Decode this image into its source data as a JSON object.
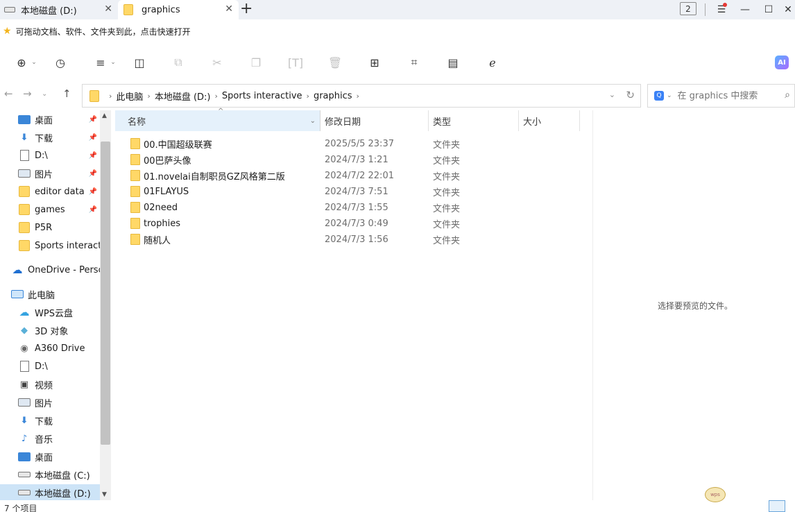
{
  "tabs": [
    {
      "label": "本地磁盘 (D:)",
      "icon": "drive-icon"
    },
    {
      "label": "graphics",
      "icon": "folder-icon"
    }
  ],
  "window": {
    "badge_count": "2"
  },
  "quickbar": {
    "text": "可拖动文档、软件、文件夹到此，点击快速打开"
  },
  "ai_label": "AI",
  "breadcrumb": [
    "此电脑",
    "本地磁盘 (D:)",
    "Sports interactive",
    "graphics"
  ],
  "search": {
    "placeholder": "在 graphics 中搜索"
  },
  "nav": {
    "quick_access": [
      {
        "label": "桌面",
        "icon": "desktop-icon",
        "pinned": true
      },
      {
        "label": "下载",
        "icon": "download-icon",
        "pinned": true
      },
      {
        "label": "D:\\",
        "icon": "document-icon",
        "pinned": true
      },
      {
        "label": "图片",
        "icon": "pictures-icon",
        "pinned": true
      },
      {
        "label": "editor data",
        "icon": "folder-icon",
        "pinned": true
      },
      {
        "label": "games",
        "icon": "folder-icon",
        "pinned": true
      },
      {
        "label": "P5R",
        "icon": "folder-icon",
        "pinned": false
      },
      {
        "label": "Sports interact",
        "icon": "folder-icon",
        "pinned": false
      }
    ],
    "onedrive": "OneDrive - Perso",
    "this_pc": "此电脑",
    "pc_items": [
      {
        "label": "WPS云盘",
        "icon": "cloud-icon"
      },
      {
        "label": "3D 对象",
        "icon": "3d-objects-icon"
      },
      {
        "label": "A360 Drive",
        "icon": "a360-icon"
      },
      {
        "label": "D:\\",
        "icon": "document-icon"
      },
      {
        "label": "视频",
        "icon": "video-icon"
      },
      {
        "label": "图片",
        "icon": "pictures-icon"
      },
      {
        "label": "下载",
        "icon": "download-icon"
      },
      {
        "label": "音乐",
        "icon": "music-icon"
      },
      {
        "label": "桌面",
        "icon": "desktop-icon"
      },
      {
        "label": "本地磁盘 (C:)",
        "icon": "drive-icon"
      },
      {
        "label": "本地磁盘 (D:)",
        "icon": "drive-icon",
        "selected": true
      }
    ]
  },
  "columns": {
    "name": "名称",
    "date": "修改日期",
    "type": "类型",
    "size": "大小"
  },
  "files": [
    {
      "name": "00.中国超级联赛",
      "date": "2025/5/5 23:37",
      "type": "文件夹"
    },
    {
      "name": "00巴萨头像",
      "date": "2024/7/3 1:21",
      "type": "文件夹"
    },
    {
      "name": "01.novelai自制职员GZ风格第二版",
      "date": "2024/7/2 22:01",
      "type": "文件夹"
    },
    {
      "name": "01FLAYUS",
      "date": "2024/7/3 7:51",
      "type": "文件夹"
    },
    {
      "name": "02need",
      "date": "2024/7/3 1:55",
      "type": "文件夹"
    },
    {
      "name": "trophies",
      "date": "2024/7/3 0:49",
      "type": "文件夹"
    },
    {
      "name": "随机人",
      "date": "2024/7/3 1:56",
      "type": "文件夹"
    }
  ],
  "preview_message": "选择要预览的文件。",
  "status": {
    "item_count": "7 个项目"
  },
  "mascot_text": "wps"
}
